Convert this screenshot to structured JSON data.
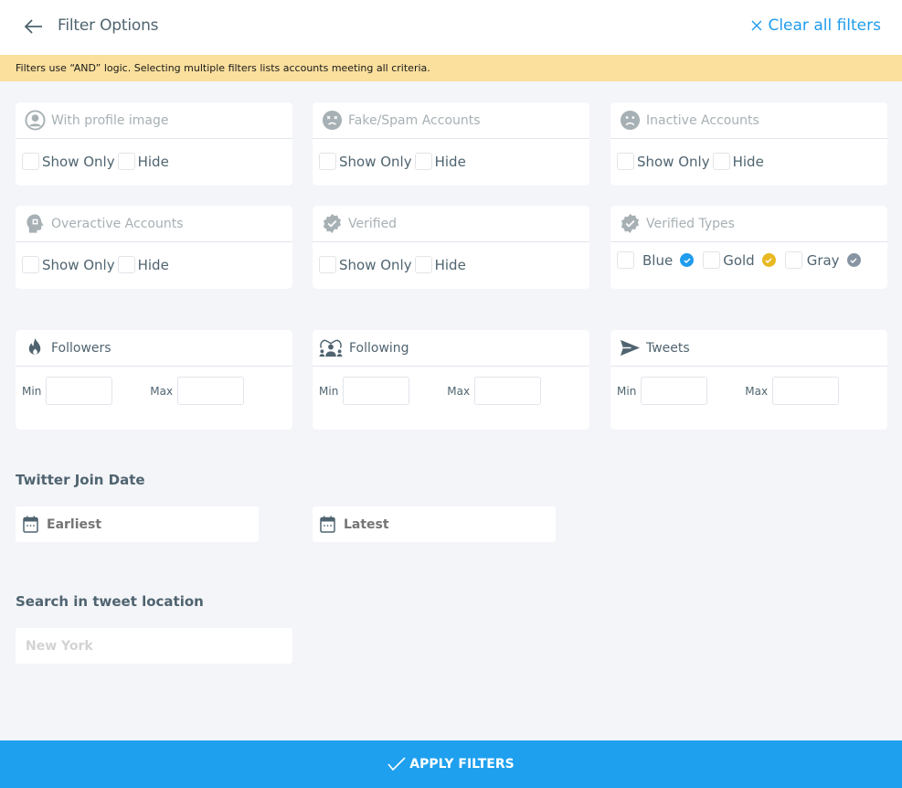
{
  "header": {
    "title": "Filter Options",
    "clear_label": "Clear all filters",
    "back_icon": "arrow-left-icon",
    "clear_icon": "close-icon"
  },
  "notice": "Filters use “AND” logic. Selecting multiple filters lists accounts meeting all criteria.",
  "toggle_filters": [
    {
      "label": "With profile image",
      "icon": "user-circle-icon",
      "show_only": "Show Only",
      "hide": "Hide"
    },
    {
      "label": "Fake/Spam Accounts",
      "icon": "dizzy-face-icon",
      "show_only": "Show Only",
      "hide": "Hide"
    },
    {
      "label": "Inactive Accounts",
      "icon": "sad-face-icon",
      "show_only": "Show Only",
      "hide": "Hide"
    },
    {
      "label": "Overactive Accounts",
      "icon": "head-gear-icon",
      "show_only": "Show Only",
      "hide": "Hide"
    },
    {
      "label": "Verified",
      "icon": "verified-badge-icon",
      "show_only": "Show Only",
      "hide": "Hide"
    }
  ],
  "verified_types": {
    "label": "Verified Types",
    "icon": "verified-badge-icon",
    "options": [
      {
        "label": "Blue",
        "color": "#1f9cec"
      },
      {
        "label": "Gold",
        "color": "#e8b923"
      },
      {
        "label": "Gray",
        "color": "#8795a3"
      }
    ]
  },
  "range_filters": [
    {
      "label": "Followers",
      "icon": "fire-icon",
      "min_label": "Min",
      "max_label": "Max",
      "min_value": "",
      "max_value": ""
    },
    {
      "label": "Following",
      "icon": "users-group-icon",
      "min_label": "Min",
      "max_label": "Max",
      "min_value": "",
      "max_value": ""
    },
    {
      "label": "Tweets",
      "icon": "send-icon",
      "min_label": "Min",
      "max_label": "Max",
      "min_value": "",
      "max_value": ""
    }
  ],
  "join_date": {
    "title": "Twitter Join Date",
    "earliest": "Earliest",
    "latest": "Latest",
    "icon": "calendar-icon"
  },
  "location": {
    "title": "Search in tweet location",
    "placeholder": "New York",
    "value": ""
  },
  "apply_label": "APPLY FILTERS",
  "colors": {
    "accent": "#1fa0ef",
    "notice_bg": "#fadf9d",
    "text": "#4f6470",
    "muted": "#a7b0b4"
  }
}
